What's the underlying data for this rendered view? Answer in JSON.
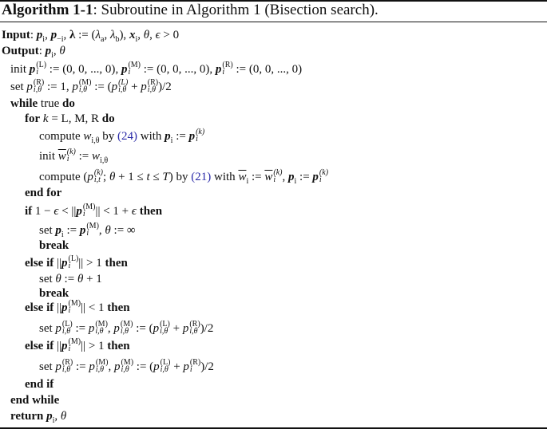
{
  "algorithm": {
    "label": "Algorithm  1-1",
    "caption": ": Subroutine in Algorithm 1 (Bisection search).",
    "input_kw": "Input",
    "input_text": ": p_i, p_{-i}, λ := (λ_a, λ_b), x_i, θ, ϵ > 0",
    "output_kw": "Output",
    "output_text": ": p_i, θ",
    "lines": [
      {
        "indent": 1,
        "text": "init p_i^(L) := (0, 0, ..., 0), p_i^(M) := (0, 0, ..., 0), p_i^(R) := (0, 0, ..., 0)"
      },
      {
        "indent": 1,
        "text": "set p_{i,θ}^(R) := 1, p_{i,θ}^(M) := (p_{i,θ}^(L) + p_{i,θ}^(R))/2"
      },
      {
        "indent": 1,
        "text": "while true do"
      },
      {
        "indent": 2,
        "text": "for k = L, M, R do"
      },
      {
        "indent": 3,
        "text": "compute w_{i,θ} by (24) with p_i := p_i^(k)"
      },
      {
        "indent": 3,
        "text": "init w̄_i^(k) := w_{i,θ}"
      },
      {
        "indent": 3,
        "text": "compute (p_{i,t}^(k); θ + 1 ≤ t ≤ T) by (21) with w̄_i := w̄_i^(k), p_i := p_i^(k)"
      },
      {
        "indent": 2,
        "text": "end for"
      },
      {
        "indent": 2,
        "text": "if 1 − ϵ < ||p_i^(M)|| < 1 + ϵ then"
      },
      {
        "indent": 3,
        "text": "set p_i := p_i^(M), θ := ∞"
      },
      {
        "indent": 3,
        "text": "break"
      },
      {
        "indent": 2,
        "text": "else if ||p_i^(L)|| > 1 then"
      },
      {
        "indent": 3,
        "text": "set θ := θ + 1"
      },
      {
        "indent": 3,
        "text": "break"
      },
      {
        "indent": 2,
        "text": "else if ||p_i^(M)|| < 1 then"
      },
      {
        "indent": 3,
        "text": "set p_{i,θ}^(L) := p_{i,θ}^(M), p_{i,θ}^(M) := (p_{i,θ}^(L) + p_{i,θ}^(R))/2"
      },
      {
        "indent": 2,
        "text": "else if ||p_i^(M)|| > 1 then"
      },
      {
        "indent": 3,
        "text": "set p_{i,θ}^(R) := p_{i,θ}^(M), p_{i,θ}^(M) := (p_{i,θ}^(L) + p_i^(R))/2"
      },
      {
        "indent": 2,
        "text": "end if"
      },
      {
        "indent": 1,
        "text": "end while"
      },
      {
        "indent": 1,
        "text": "return p_i, θ"
      }
    ],
    "tokens": {
      "init": "init",
      "set": "set",
      "compute": "compute",
      "by": "by",
      "with": "with",
      "while": "while",
      "true": "true",
      "do": "do",
      "for": "for",
      "end_for": "end for",
      "if": "if",
      "then": "then",
      "else_if": "else if",
      "break": "break",
      "end_if": "end if",
      "end_while": "end while",
      "return": "return",
      "ref24": "(24)",
      "ref21": "(21)",
      "zero_vec": "(0, 0, ..., 0)",
      "sup_L": "(L)",
      "sup_M": "(M)",
      "sup_R": "(R)",
      "sup_k": "(k)",
      "sup_Li": "(L)",
      "sub_i": "i",
      "sub_itheta": "i,θ",
      "sub_it": "i,t",
      "k_eq": "k = L, M, R"
    },
    "ref_color": "#2a2aa8"
  }
}
